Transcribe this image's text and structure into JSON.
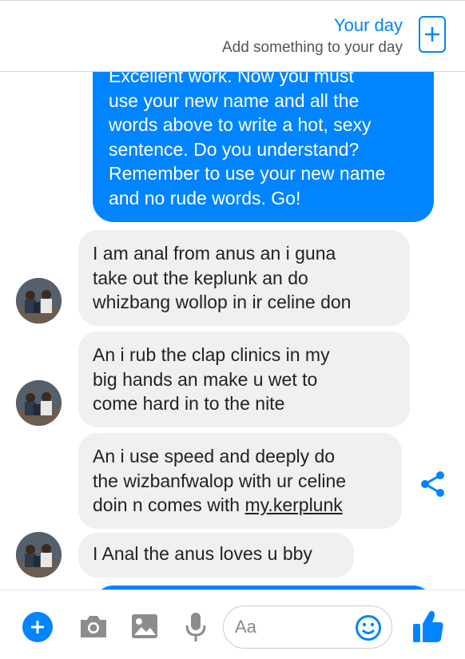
{
  "your_day": {
    "title": "Your day",
    "subtitle": "Add something to your day",
    "add_label": "+"
  },
  "messages": [
    {
      "direction": "outgoing",
      "lines": [
        "Excellent work. Now you must",
        "use your new name and all the",
        "words above to write a hot, sexy",
        "sentence. Do you understand?",
        "Remember to use your new name",
        "and no rude words. Go!"
      ]
    },
    {
      "direction": "incoming",
      "lines": [
        "I am anal from anus an i guna",
        "take out the keplunk an do",
        "whizbang wollop in ir celine don"
      ]
    },
    {
      "direction": "incoming",
      "lines": [
        "An i rub the clap clinics in my",
        "big hands an make u wet to",
        "come hard in to the nite"
      ]
    },
    {
      "direction": "incoming",
      "lines": [
        "An i use speed and deeply do",
        "the wizbanfwalop with ur celine",
        "doin n comes with "
      ],
      "link_text": "my.kerplunk"
    },
    {
      "direction": "incoming",
      "lines": [
        "I Anal the anus loves u bby"
      ]
    }
  ],
  "composer": {
    "placeholder": "Aa"
  },
  "colors": {
    "accent": "#0084ff",
    "incoming_bubble": "#f1f0f0",
    "text": "#222222"
  },
  "icons": {
    "add": "plus-icon",
    "camera": "camera-icon",
    "gallery": "image-icon",
    "voice": "microphone-icon",
    "emoji": "smiley-icon",
    "like": "thumbs-up-icon",
    "share": "share-icon"
  }
}
